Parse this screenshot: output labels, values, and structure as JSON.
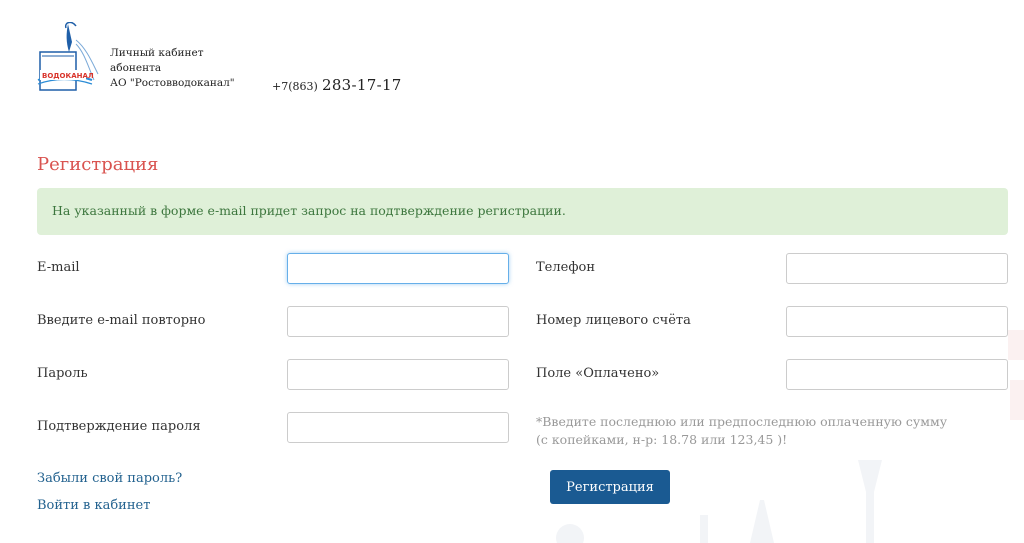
{
  "header": {
    "logo_text": "ВОДОКАНАЛ",
    "brand_line1": "Личный кабинет",
    "brand_line2": "абонента",
    "brand_line3": "АО \"Ростовводоканал\"",
    "phone_prefix": "+7(863)",
    "phone_number": "283-17-17"
  },
  "page": {
    "title": "Регистрация",
    "alert": "На указанный в форме e-mail придет запрос на подтверждение регистрации."
  },
  "form": {
    "email_label": "E-mail",
    "email_repeat_label": "Введите e-mail повторно",
    "password_label": "Пароль",
    "password_confirm_label": "Подтверждение пароля",
    "phone_label": "Телефон",
    "account_label": "Номер лицевого счёта",
    "paid_label": "Поле «Оплачено»",
    "hint_line1": "*Введите последнюю или предпоследнюю оплаченную сумму",
    "hint_line2": "(с копейками, н-р: 18.78 или 123,45 )!",
    "submit_label": "Регистрация"
  },
  "links": {
    "forgot_password": "Забыли свой пароль?",
    "login": "Войти в кабинет"
  },
  "colors": {
    "title": "#d9534f",
    "alert_bg": "#dff0d8",
    "alert_text": "#3c763d",
    "link": "#23628f",
    "button_bg": "#1a5a92",
    "hint": "#999999"
  }
}
